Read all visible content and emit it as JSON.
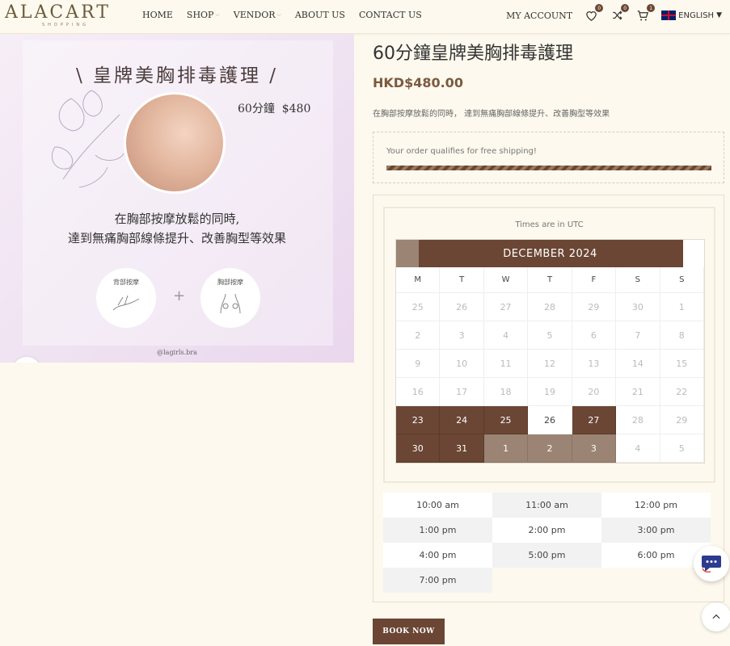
{
  "header": {
    "logo": "ALACART",
    "logo_sub": "SHOPPING",
    "nav": [
      {
        "label": "HOME"
      },
      {
        "label": "SHOP"
      },
      {
        "label": "VENDOR"
      },
      {
        "label": "ABOUT US"
      },
      {
        "label": "CONTACT US"
      }
    ],
    "my_account": "MY ACCOUNT",
    "wishlist_count": "0",
    "compare_count": "0",
    "cart_count": "1",
    "language": "ENGLISH"
  },
  "image": {
    "title": "皇牌美胸排毒護理",
    "duration_price": "60分鐘",
    "price_text": "$480",
    "line1": "在胸部按摩放鬆的同時,",
    "line2": "達到無痛胸部線條提升、改善胸型等效果",
    "circle1": "背部按摩",
    "circle2": "胸部按摩",
    "plus": "+",
    "handle": "@lagirls.bra"
  },
  "product": {
    "title": "60分鐘皇牌美胸排毒護理",
    "price": "HKD$480.00",
    "description": "在胸部按摩放鬆的同時， 達到無痛胸部線條提升、改善胸型等效果",
    "shipping_msg": "Your order qualifies for free shipping!",
    "shipping_progress": 1.0
  },
  "booking": {
    "timezone_note": "Times are in UTC",
    "month_label": "DECEMBER 2024",
    "weekdays": [
      "M",
      "T",
      "W",
      "T",
      "F",
      "S",
      "S"
    ],
    "days": [
      {
        "d": "25",
        "s": "past"
      },
      {
        "d": "26",
        "s": "past"
      },
      {
        "d": "27",
        "s": "past"
      },
      {
        "d": "28",
        "s": "past"
      },
      {
        "d": "29",
        "s": "past"
      },
      {
        "d": "30",
        "s": "past"
      },
      {
        "d": "1",
        "s": "past"
      },
      {
        "d": "2",
        "s": "past"
      },
      {
        "d": "3",
        "s": "past"
      },
      {
        "d": "4",
        "s": "past"
      },
      {
        "d": "5",
        "s": "past"
      },
      {
        "d": "6",
        "s": "past"
      },
      {
        "d": "7",
        "s": "past"
      },
      {
        "d": "8",
        "s": "past"
      },
      {
        "d": "9",
        "s": "past"
      },
      {
        "d": "10",
        "s": "past"
      },
      {
        "d": "11",
        "s": "past"
      },
      {
        "d": "12",
        "s": "past"
      },
      {
        "d": "13",
        "s": "past"
      },
      {
        "d": "14",
        "s": "past"
      },
      {
        "d": "15",
        "s": "past"
      },
      {
        "d": "16",
        "s": "past"
      },
      {
        "d": "17",
        "s": "past"
      },
      {
        "d": "18",
        "s": "past"
      },
      {
        "d": "19",
        "s": "past"
      },
      {
        "d": "20",
        "s": "past"
      },
      {
        "d": "21",
        "s": "past"
      },
      {
        "d": "22",
        "s": "past"
      },
      {
        "d": "23",
        "s": "avail"
      },
      {
        "d": "24",
        "s": "avail"
      },
      {
        "d": "25",
        "s": "avail"
      },
      {
        "d": "26",
        "s": "today"
      },
      {
        "d": "27",
        "s": "avail"
      },
      {
        "d": "28",
        "s": "past"
      },
      {
        "d": "29",
        "s": "past"
      },
      {
        "d": "30",
        "s": "avail"
      },
      {
        "d": "31",
        "s": "avail"
      },
      {
        "d": "1",
        "s": "sel"
      },
      {
        "d": "2",
        "s": "sel"
      },
      {
        "d": "3",
        "s": "sel"
      },
      {
        "d": "4",
        "s": "past"
      },
      {
        "d": "5",
        "s": "past"
      }
    ],
    "time_slots": [
      "10:00 am",
      "11:00 am",
      "12:00 pm",
      "1:00 pm",
      "2:00 pm",
      "3:00 pm",
      "4:00 pm",
      "5:00 pm",
      "6:00 pm",
      "7:00 pm"
    ],
    "book_now": "BOOK NOW"
  },
  "colors": {
    "brand": "#6b4634",
    "brand_light": "#9b8474",
    "price": "#7b5a3e",
    "background": "#fdf9ee"
  },
  "icons": [
    "heart-icon",
    "compare-icon",
    "cart-icon",
    "uk-flag-icon",
    "zoom-icon",
    "chat-icon",
    "chevron-up-icon"
  ]
}
